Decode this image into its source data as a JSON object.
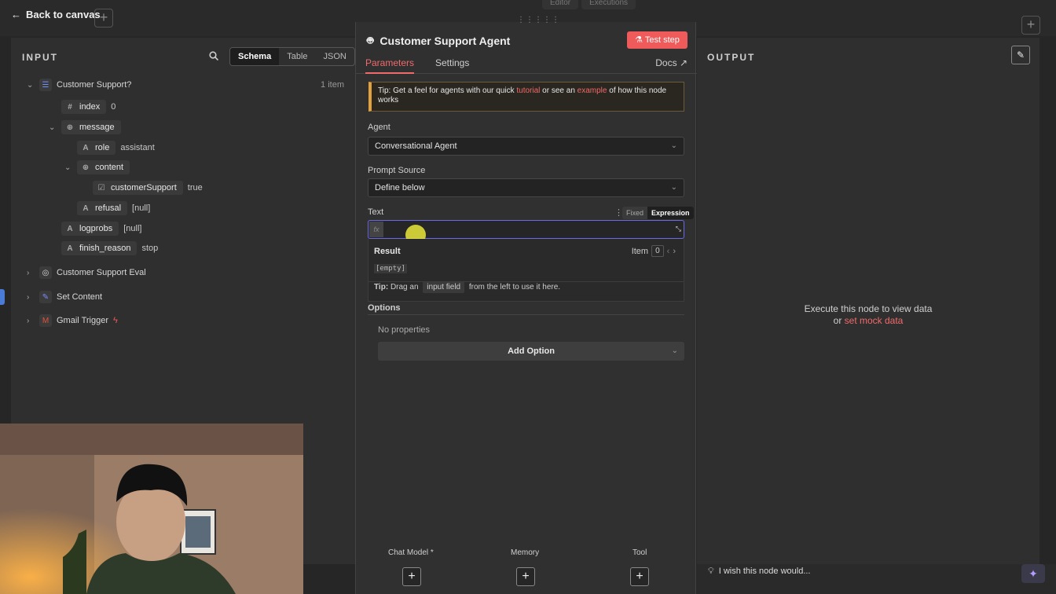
{
  "topbar": {
    "back_label": "Back to canvas",
    "tabs": [
      "Editor",
      "Executions"
    ]
  },
  "input": {
    "title": "INPUT",
    "views": [
      "Schema",
      "Table",
      "JSON"
    ],
    "node_name": "Customer Support?",
    "item_count": "1 item",
    "fields": [
      {
        "type": "#",
        "name": "index",
        "value": "0"
      },
      {
        "type": "⊕",
        "name": "message",
        "value": ""
      },
      {
        "type": "A",
        "name": "role",
        "value": "assistant"
      },
      {
        "type": "⊕",
        "name": "content",
        "value": ""
      },
      {
        "type": "☑",
        "name": "customerSupport",
        "value": "true"
      },
      {
        "type": "A",
        "name": "refusal",
        "value": "[null]"
      },
      {
        "type": "A",
        "name": "logprobs",
        "value": "[null]"
      },
      {
        "type": "A",
        "name": "finish_reason",
        "value": "stop"
      }
    ],
    "other_nodes": [
      "Customer Support Eval",
      "Set Content",
      "Gmail Trigger"
    ]
  },
  "node": {
    "title": "Customer Support Agent",
    "test_label": "Test step",
    "tabs": [
      "Parameters",
      "Settings"
    ],
    "docs_label": "Docs",
    "tip": {
      "prefix": "Tip: Get a feel for agents with our quick ",
      "link1": "tutorial",
      "middle": " or see an ",
      "link2": "example",
      "suffix": " of how this node works"
    },
    "agent_label": "Agent",
    "agent_value": "Conversational Agent",
    "prompt_source_label": "Prompt Source",
    "prompt_source_value": "Define below",
    "text_label": "Text",
    "mode_fixed": "Fixed",
    "mode_expression": "Expression",
    "fx_label": "fx",
    "result_label": "Result",
    "item_label": "Item",
    "item_index": "0",
    "empty_value": "[empty]",
    "hint_prefix": "Tip:",
    "hint_a": "Drag an",
    "hint_code": "input field",
    "hint_b": "from the left to use it here.",
    "options_label": "Options",
    "no_properties": "No properties",
    "add_option": "Add Option",
    "sub_nodes": [
      "Chat Model *",
      "Memory",
      "Tool"
    ]
  },
  "output": {
    "title": "OUTPUT",
    "line1": "Execute this node to view data",
    "or": "or ",
    "mock_link": "set mock data"
  },
  "bottom": {
    "wish_text": "I wish this node would..."
  },
  "colors": {
    "accent": "#ef5a5a",
    "tip_border": "#e2a23b",
    "focus": "#6a6ae6"
  }
}
